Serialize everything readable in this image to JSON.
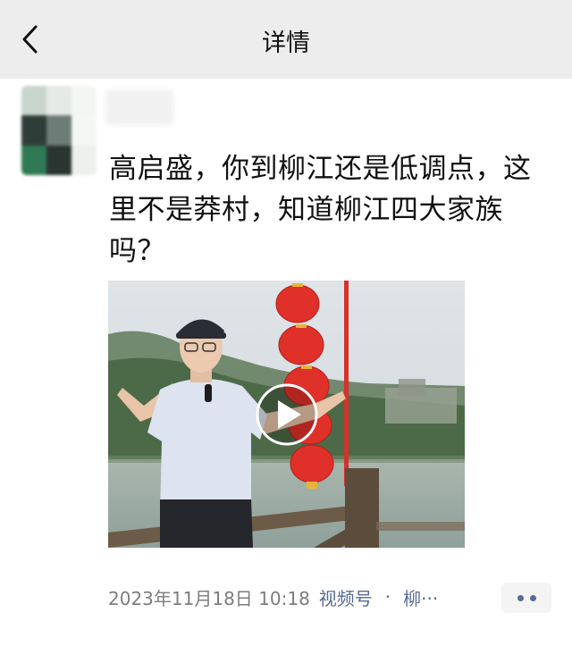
{
  "navbar": {
    "title": "详情",
    "back_icon": "chevron-left-icon"
  },
  "post": {
    "avatar_tiles": [
      "#c9d6cc",
      "#e6eae6",
      "#f4f6f4",
      "#2f3d39",
      "#6d7c77",
      "#f5f7f5",
      "#2f7a55",
      "#2a3430",
      "#eef0ee"
    ],
    "author_name": "",
    "text": "高启盛，你到柳江还是低调点，这里不是莽村，知道柳江四大家族吗？",
    "video_play_icon": "play-icon",
    "timestamp": "2023年11月18日 10:18",
    "source": "视频号",
    "separator": "·",
    "location": "柳···",
    "more_icon": "more-dots-icon"
  },
  "colors": {
    "navbar_bg": "#ededed",
    "link": "#576b95",
    "meta_text": "#7d7d7d",
    "lantern_red": "#e0302a"
  }
}
